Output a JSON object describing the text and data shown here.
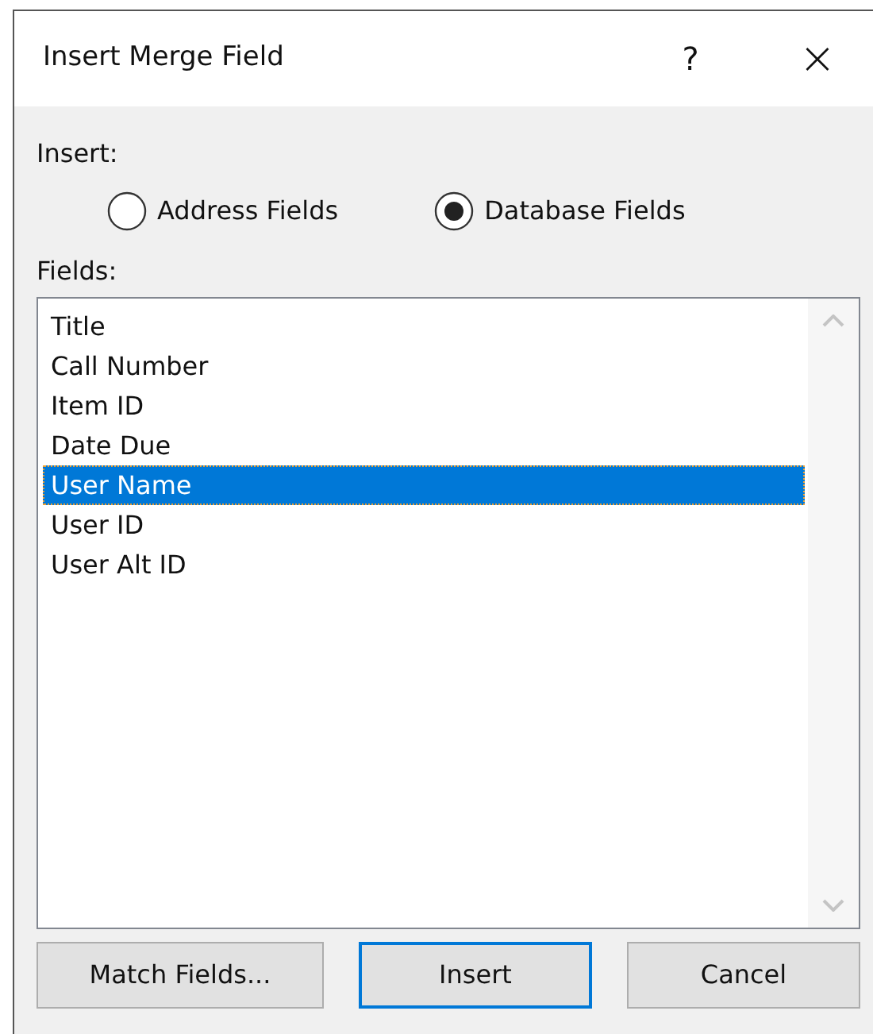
{
  "window": {
    "title": "Insert Merge Field",
    "help": "?",
    "close": "×"
  },
  "insert_label": "Insert:",
  "radios": [
    {
      "label": "Address Fields",
      "selected": false
    },
    {
      "label": "Database Fields",
      "selected": true
    }
  ],
  "fields_label": "Fields:",
  "fields": [
    {
      "label": "Title",
      "selected": false
    },
    {
      "label": "Call Number",
      "selected": false
    },
    {
      "label": "Item ID",
      "selected": false
    },
    {
      "label": "Date Due",
      "selected": false
    },
    {
      "label": "User Name",
      "selected": true
    },
    {
      "label": "User ID",
      "selected": false
    },
    {
      "label": "User Alt ID",
      "selected": false
    }
  ],
  "buttons": [
    {
      "label": "Match Fields...",
      "default": false
    },
    {
      "label": "Insert",
      "default": true
    },
    {
      "label": "Cancel",
      "default": false
    }
  ]
}
